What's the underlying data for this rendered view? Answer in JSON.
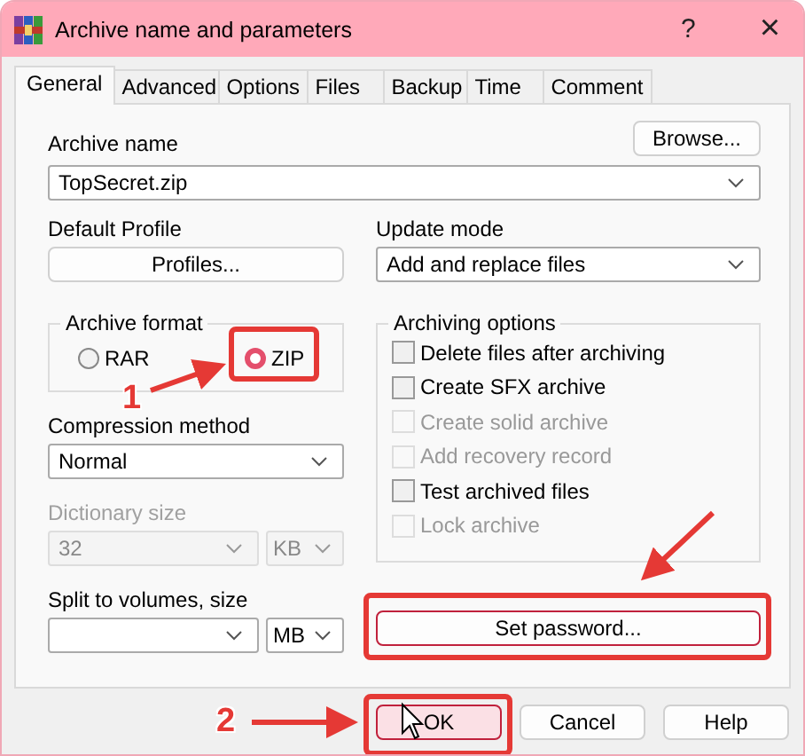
{
  "window": {
    "title": "Archive name and parameters",
    "help": "?",
    "close": "×"
  },
  "tabs": [
    {
      "label": "General",
      "selected": true
    },
    {
      "label": "Advanced",
      "selected": false
    },
    {
      "label": "Options",
      "selected": false
    },
    {
      "label": "Files",
      "selected": false
    },
    {
      "label": "Backup",
      "selected": false
    },
    {
      "label": "Time",
      "selected": false
    },
    {
      "label": "Comment",
      "selected": false
    }
  ],
  "archive_name": {
    "label": "Archive name",
    "value": "TopSecret.zip",
    "browse": "Browse..."
  },
  "default_profile": {
    "label": "Default Profile",
    "button": "Profiles..."
  },
  "update_mode": {
    "label": "Update mode",
    "value": "Add and replace files"
  },
  "archive_format": {
    "label": "Archive format",
    "options": [
      {
        "label": "RAR",
        "selected": false
      },
      {
        "label": "ZIP",
        "selected": true
      }
    ]
  },
  "compression_method": {
    "label": "Compression method",
    "value": "Normal"
  },
  "dictionary_size": {
    "label": "Dictionary size",
    "value": "32",
    "unit": "KB",
    "disabled": true
  },
  "split_volumes": {
    "label": "Split to volumes, size",
    "unit": "MB"
  },
  "archiving_options": {
    "label": "Archiving options",
    "items": [
      {
        "label": "Delete files after archiving",
        "checked": false,
        "disabled": false
      },
      {
        "label": "Create SFX archive",
        "checked": false,
        "disabled": false
      },
      {
        "label": "Create solid archive",
        "checked": false,
        "disabled": true
      },
      {
        "label": "Add recovery record",
        "checked": false,
        "disabled": true
      },
      {
        "label": "Test archived files",
        "checked": false,
        "disabled": false
      },
      {
        "label": "Lock archive",
        "checked": false,
        "disabled": true
      }
    ]
  },
  "set_password": "Set password...",
  "buttons": [
    {
      "label": "OK",
      "hovered": true
    },
    {
      "label": "Cancel",
      "hovered": false
    },
    {
      "label": "Help",
      "hovered": false
    }
  ],
  "steps": [
    "1",
    "2"
  ]
}
